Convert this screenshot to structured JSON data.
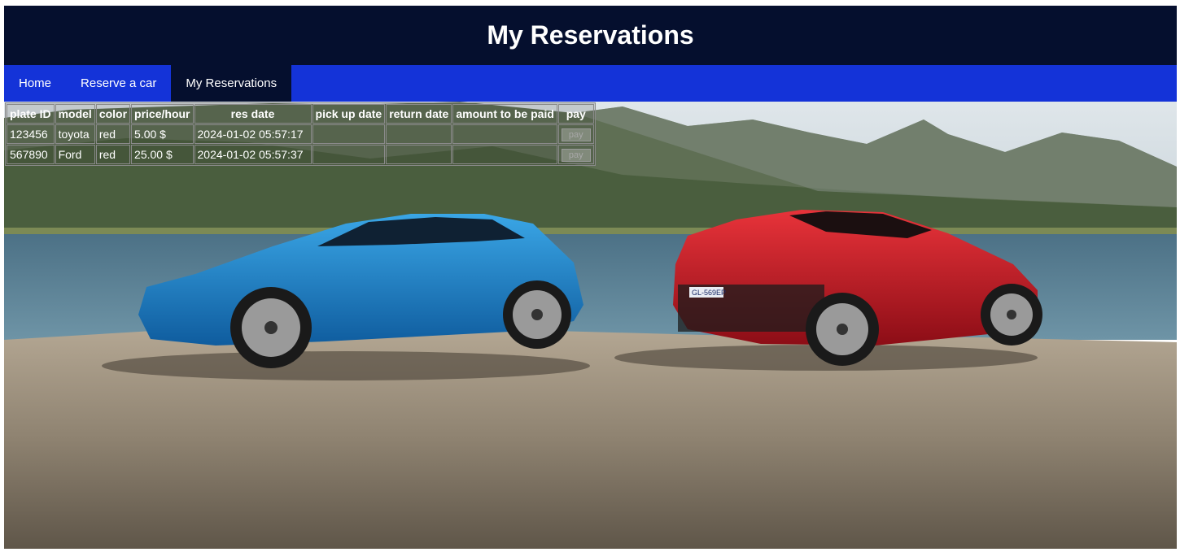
{
  "header": {
    "title": "My Reservations"
  },
  "nav": {
    "items": [
      {
        "label": "Home"
      },
      {
        "label": "Reserve a car"
      },
      {
        "label": "My Reservations"
      }
    ]
  },
  "table": {
    "headers": [
      "plate ID",
      "model",
      "color",
      "price/hour",
      "res date",
      "pick up date",
      "return date",
      "amount to be paid",
      "pay"
    ],
    "rows": [
      {
        "plate_id": "123456",
        "model": "toyota",
        "color": "red",
        "price": "5.00 $",
        "res_date": "2024-01-02 05:57:17",
        "pickup": "",
        "return": "",
        "amount": "",
        "pay_label": "pay"
      },
      {
        "plate_id": "567890",
        "model": "Ford",
        "color": "red",
        "price": "25.00 $",
        "res_date": "2024-01-02 05:57:37",
        "pickup": "",
        "return": "",
        "amount": "",
        "pay_label": "pay"
      }
    ]
  },
  "colors": {
    "header_bg": "#050f2e",
    "nav_bg": "#1433d8",
    "active_tab_bg": "#050f2e"
  },
  "background": {
    "icon": "photo-two-cars-by-lake",
    "license_plate": "GL-569EP"
  }
}
